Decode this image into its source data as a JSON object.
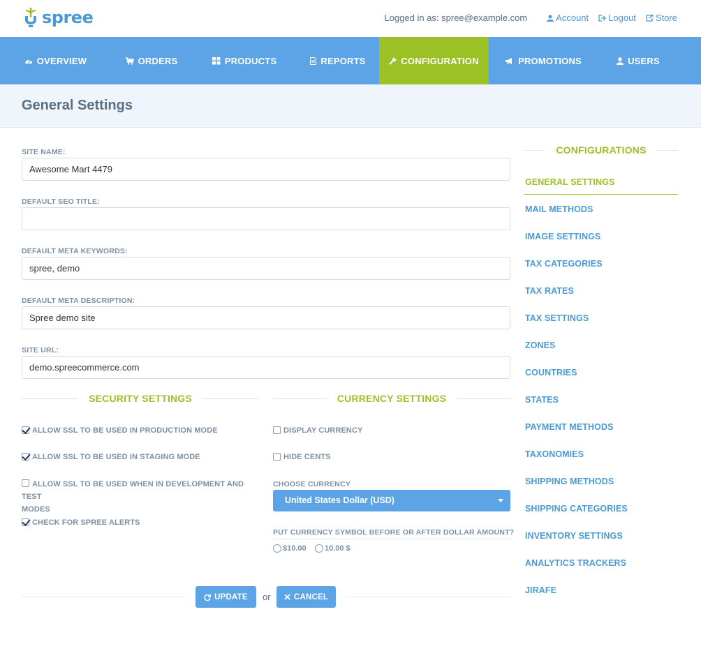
{
  "brand": {
    "logo_text": "spree",
    "logo_color": "#4c9ad3"
  },
  "user_nav": {
    "logged_in_text": "Logged in as: spree@example.com",
    "account": "Account",
    "logout": "Logout",
    "store": "Store"
  },
  "main_nav": {
    "items": [
      {
        "label": "OVERVIEW",
        "icon": "dashboard-icon"
      },
      {
        "label": "ORDERS",
        "icon": "cart-icon"
      },
      {
        "label": "PRODUCTS",
        "icon": "grid-icon"
      },
      {
        "label": "REPORTS",
        "icon": "document-icon"
      },
      {
        "label": "CONFIGURATION",
        "icon": "wrench-icon",
        "active": true
      },
      {
        "label": "PROMOTIONS",
        "icon": "megaphone-icon"
      },
      {
        "label": "USERS",
        "icon": "user-icon"
      }
    ],
    "bg_color": "#5da4e6",
    "active_color": "#9bc127"
  },
  "page": {
    "title": "General Settings"
  },
  "form": {
    "site_name": {
      "label": "SITE NAME:",
      "value": "Awesome Mart 4479"
    },
    "seo_title": {
      "label": "DEFAULT SEO TITLE:",
      "value": ""
    },
    "meta_keywords": {
      "label": "DEFAULT META KEYWORDS:",
      "value": "spree, demo"
    },
    "meta_description": {
      "label": "DEFAULT META DESCRIPTION:",
      "value": "Spree demo site"
    },
    "site_url": {
      "label": "SITE URL:",
      "value": "demo.spreecommerce.com"
    }
  },
  "security": {
    "heading": "SECURITY SETTINGS",
    "ssl_production": {
      "label": "ALLOW SSL TO BE USED IN PRODUCTION MODE",
      "checked": true
    },
    "ssl_staging": {
      "label": "ALLOW SSL TO BE USED IN STAGING MODE",
      "checked": true
    },
    "ssl_dev_line1": "ALLOW SSL TO BE USED WHEN IN DEVELOPMENT AND TEST",
    "ssl_dev_line2": "MODES",
    "ssl_dev_checked": false,
    "alerts": {
      "label": "CHECK FOR SPREE ALERTS",
      "checked": true
    }
  },
  "currency": {
    "heading": "CURRENCY SETTINGS",
    "display_currency": {
      "label": "DISPLAY CURRENCY",
      "checked": false
    },
    "hide_cents": {
      "label": "HIDE CENTS",
      "checked": false
    },
    "choose_label": "CHOOSE CURRENCY",
    "selected": "United States Dollar (USD)",
    "symbol_question": "PUT CURRENCY SYMBOL BEFORE OR AFTER DOLLAR AMOUNT?",
    "before_option": "$10.00",
    "after_option": "10.00 $"
  },
  "actions": {
    "update": "UPDATE",
    "or": "or",
    "cancel": "CANCEL"
  },
  "sidebar": {
    "heading": "CONFIGURATIONS",
    "items": [
      {
        "label": "GENERAL SETTINGS",
        "active": true
      },
      {
        "label": "MAIL METHODS"
      },
      {
        "label": "IMAGE SETTINGS"
      },
      {
        "label": "TAX CATEGORIES"
      },
      {
        "label": "TAX RATES"
      },
      {
        "label": "TAX SETTINGS"
      },
      {
        "label": "ZONES"
      },
      {
        "label": "COUNTRIES"
      },
      {
        "label": "STATES"
      },
      {
        "label": "PAYMENT METHODS"
      },
      {
        "label": "TAXONOMIES"
      },
      {
        "label": "SHIPPING METHODS"
      },
      {
        "label": "SHIPPING CATEGORIES"
      },
      {
        "label": "INVENTORY SETTINGS"
      },
      {
        "label": "ANALYTICS TRACKERS"
      },
      {
        "label": "JIRAFE"
      }
    ]
  }
}
